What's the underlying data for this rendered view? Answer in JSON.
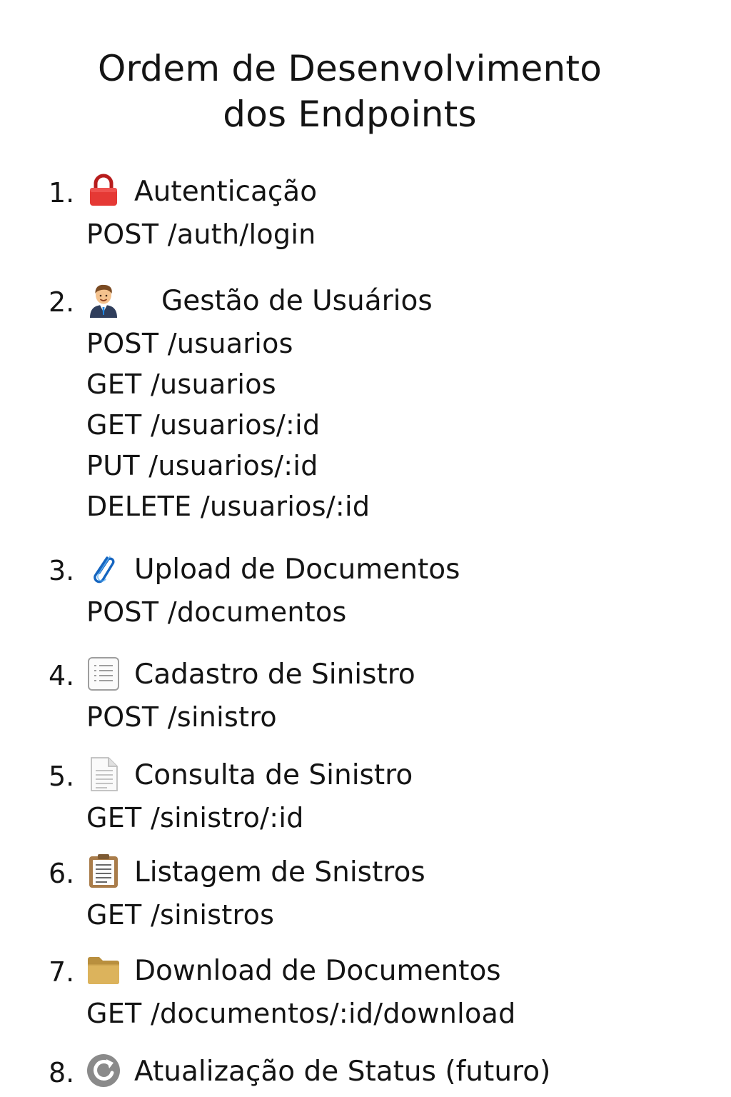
{
  "title": {
    "line1": "Ordem de Desenvolvimento",
    "line2": "dos Endpoints"
  },
  "items": [
    {
      "number": "1.",
      "icon": "lock-icon",
      "label": "Autenticação",
      "endpoints": [
        "POST /auth/login"
      ]
    },
    {
      "number": "2.",
      "icon": "person-icon",
      "label": "Gestão de Usuários",
      "endpoints": [
        "POST /usuarios",
        "GET /usuarios",
        "GET /usuarios/:id",
        "PUT /usuarios/:id",
        "DELETE /usuarios/:id"
      ]
    },
    {
      "number": "3.",
      "icon": "paperclip-icon",
      "label": "Upload de Documentos",
      "endpoints": [
        "POST /documentos"
      ]
    },
    {
      "number": "4.",
      "icon": "list-document-icon",
      "label": "Cadastro de Sinistro",
      "endpoints": [
        "POST /sinistro"
      ]
    },
    {
      "number": "5.",
      "icon": "page-document-icon",
      "label": "Consulta de Sinistro",
      "endpoints": [
        "GET /sinistro/:id"
      ]
    },
    {
      "number": "6.",
      "icon": "clipboard-icon",
      "label": "Listagem de Snistros",
      "endpoints": [
        "GET /sinistros"
      ]
    },
    {
      "number": "7.",
      "icon": "folder-icon",
      "label": "Download de Documentos",
      "endpoints": [
        "GET /documentos/:id/download"
      ]
    },
    {
      "number": "8.",
      "icon": "refresh-icon",
      "label": "Atualização de Status (futuro)",
      "endpoints": []
    }
  ]
}
